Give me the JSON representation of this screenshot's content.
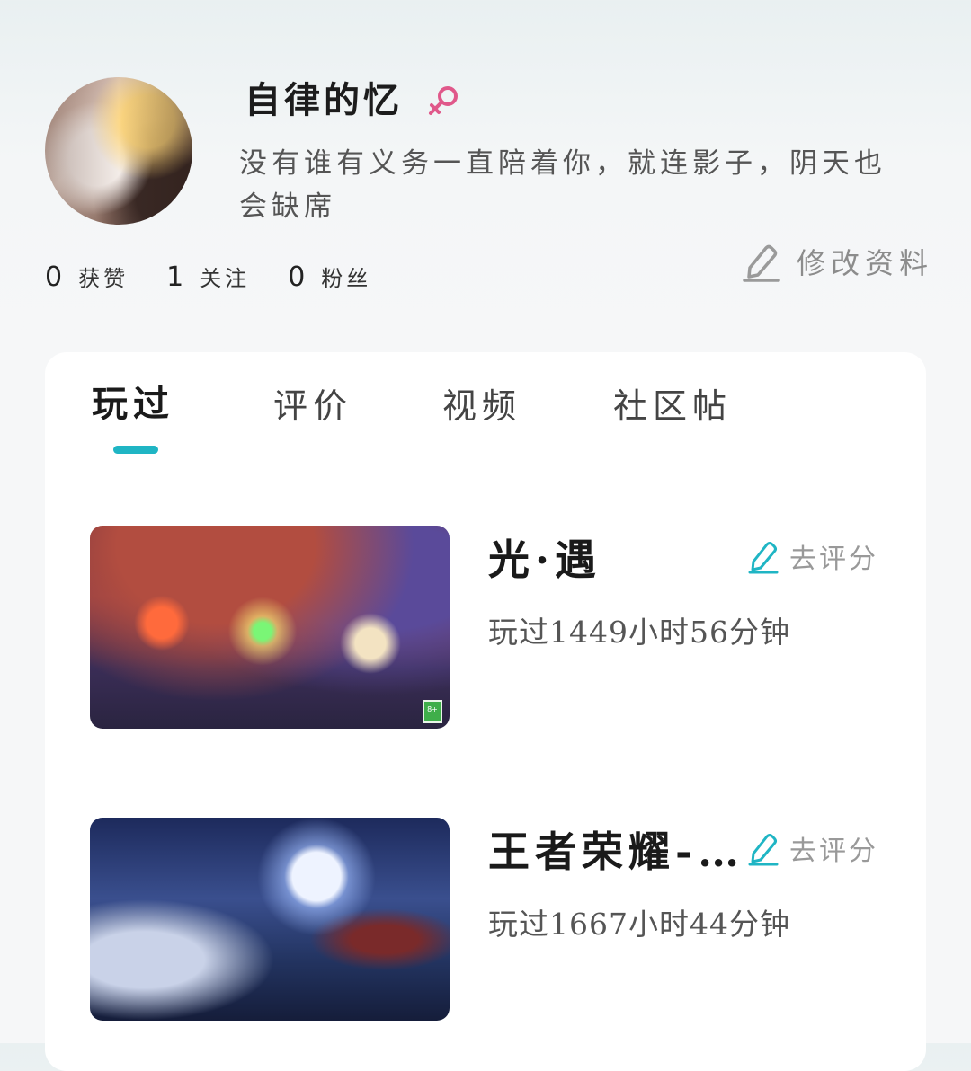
{
  "profile": {
    "username": "自律的忆",
    "bio": "没有谁有义务一直陪着你，就连影子，阴天也会缺席",
    "gender": "female",
    "gender_color": "#e0588a"
  },
  "stats": [
    {
      "num": "0",
      "label": "获赞"
    },
    {
      "num": "1",
      "label": "关注"
    },
    {
      "num": "0",
      "label": "粉丝"
    }
  ],
  "edit_profile_label": "修改资料",
  "tabs": [
    "玩过",
    "评价",
    "视频",
    "社区帖"
  ],
  "active_tab": "玩过",
  "accent_color": "#1fb5c4",
  "games": [
    {
      "title": "光·遇",
      "rate_label": "去评分",
      "played": "玩过1449小时56分钟",
      "age_badge": "8+"
    },
    {
      "title": "王者荣耀-…",
      "rate_label": "去评分",
      "played": "玩过1667小时44分钟"
    }
  ]
}
